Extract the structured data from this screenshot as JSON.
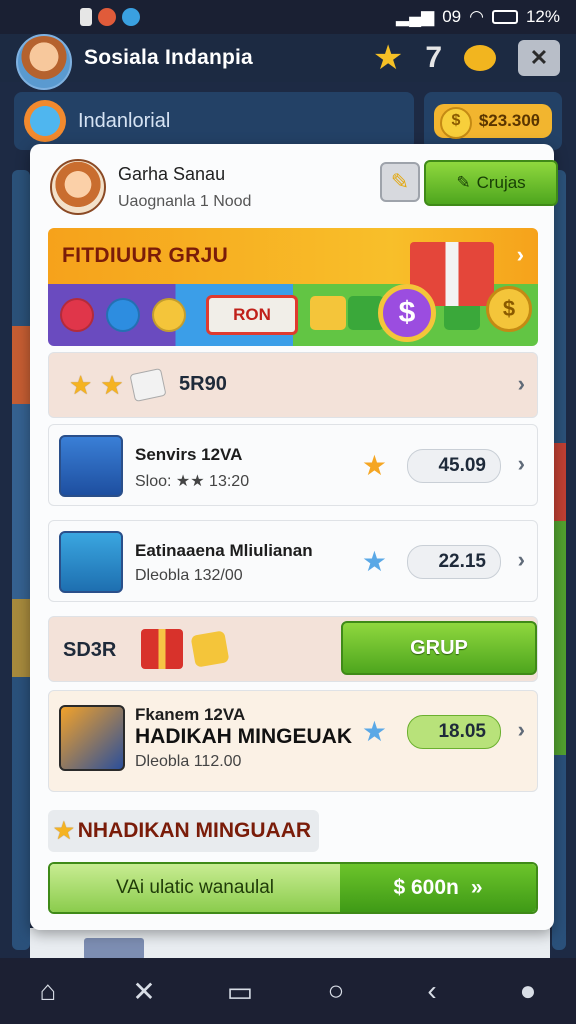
{
  "status_bar": {
    "time": "09",
    "battery": "12%"
  },
  "app": {
    "title": "Sosiala Indanpia"
  },
  "background": {
    "panel_title": "Indanlorial",
    "coin_amount": "$23.30θ"
  },
  "profile": {
    "name": "Garha Sanau",
    "subtitle": "Uaognanla 1 Nood"
  },
  "buttons": {
    "crujas": "Crujas"
  },
  "featured": {
    "title": "FITDIUUR GRJU",
    "ron_label": "RON"
  },
  "reward": {
    "code": "5R90"
  },
  "items": [
    {
      "name": "Senvirs 12VA",
      "sub": "Sloo: ★★ 13:20",
      "price": "45.09"
    },
    {
      "name": "Eatinaaena Mliulianan",
      "sub": "Dleobla 132/00",
      "price": "22.15"
    }
  ],
  "grup": {
    "label": "SD3R",
    "button": "GRUP"
  },
  "weekly_item": {
    "name": "Fkanem 12VA",
    "title": "HADIKAH MINGEUAK",
    "sub": "Dleobla 112.00",
    "price": "18.05"
  },
  "weekly_heading": "NHADIKAN MINGUAAR",
  "cta": {
    "left": "VAi ulatic wanaulal",
    "right": "$ 600n"
  },
  "colors": {
    "accent_green": "#4ea61e",
    "accent_orange": "#f6a21b",
    "dark_bg": "#1d2a44"
  }
}
